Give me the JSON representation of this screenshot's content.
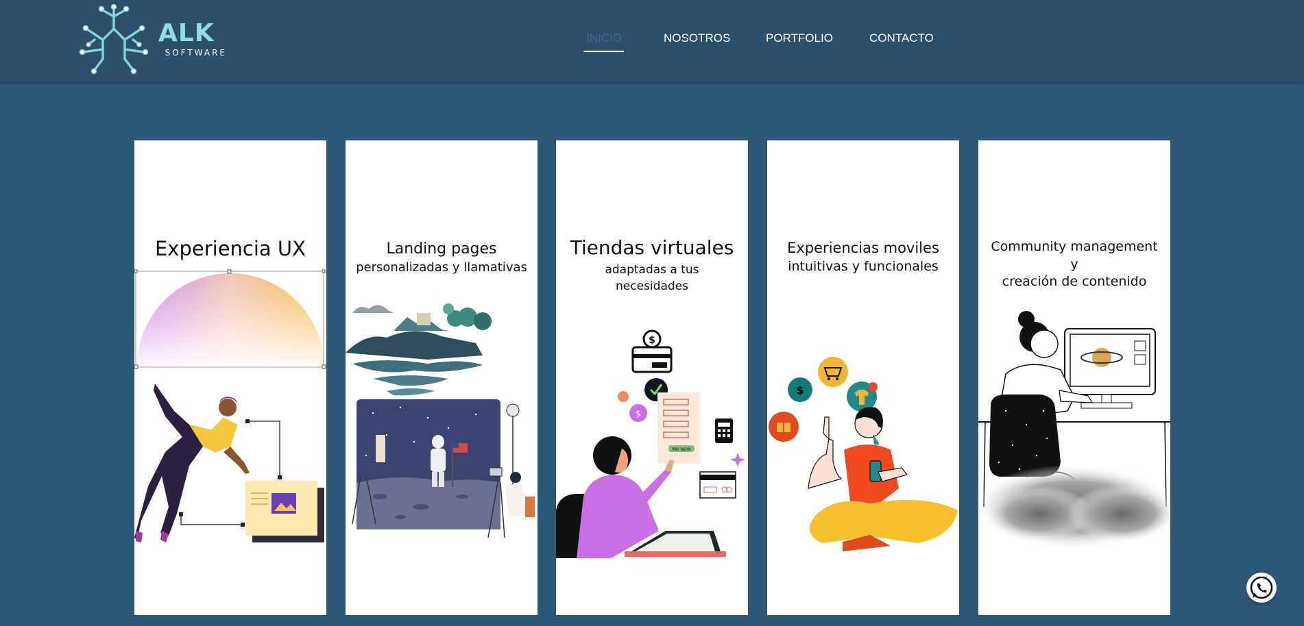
{
  "brand": {
    "name": "ALK",
    "subtitle": "SOFTWARE",
    "accent": "#8fdde6"
  },
  "nav": {
    "items": [
      {
        "label": "INICIO",
        "active": true
      },
      {
        "label": "NOSOTROS",
        "active": false
      },
      {
        "label": "PORTFOLIO",
        "active": false
      },
      {
        "label": "CONTACTO",
        "active": false
      }
    ]
  },
  "cards": [
    {
      "title": "Experiencia UX",
      "subtitle": ""
    },
    {
      "title": "Landing pages",
      "subtitle": "personalizadas y llamativas"
    },
    {
      "title": "Tiendas virtuales",
      "subtitle_line1": "adaptadas a tus",
      "subtitle_line2": "necesidades"
    },
    {
      "title_line1": "Experiencias moviles",
      "title_line2": "intuitivas y funcionales"
    },
    {
      "title_line1": "Community  management",
      "title_line2": "y",
      "title_line3": "creación de contenido"
    }
  ],
  "colors": {
    "page_bg": "#2e5878",
    "header_bg": "#2c4f6c",
    "card_bg": "#ffffff"
  },
  "icons": {
    "whatsapp": "whatsapp-icon"
  }
}
